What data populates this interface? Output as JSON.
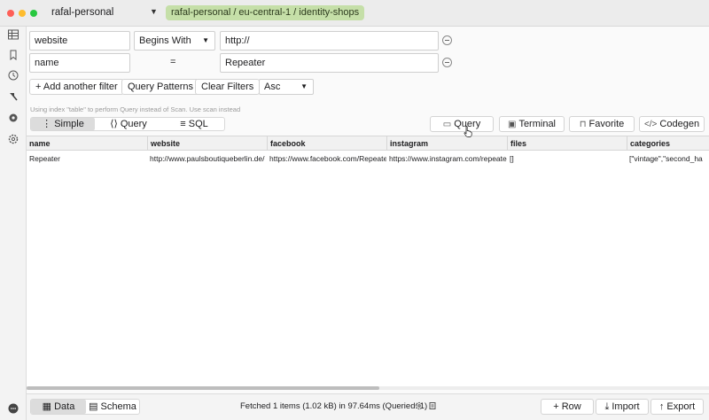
{
  "titlebar": {
    "connection": "rafal-personal",
    "breadcrumb": "rafal-personal / eu-central-1 / identity-shops"
  },
  "sidebar": {
    "icons": [
      "table-icon",
      "bookmark-icon",
      "history-icon",
      "hammer-icon",
      "settings-icon",
      "gear-icon",
      "chat-icon"
    ]
  },
  "filters": [
    {
      "attribute": "website",
      "operator": "Begins With",
      "value": "http://"
    },
    {
      "attribute": "name",
      "operator": "=",
      "value": "Repeater"
    }
  ],
  "filter_actions": {
    "add_filter": "+ Add another filter",
    "query_patterns": "Query Patterns",
    "clear_filters": "Clear Filters",
    "sort": "Asc"
  },
  "hint": "Using index \"table\" to perform Query instead of Scan. Use scan instead",
  "modes": {
    "simple": "Simple",
    "query": "Query",
    "sql": "SQL"
  },
  "toolbar": {
    "query": "Query",
    "terminal": "Terminal",
    "favorite": "Favorite",
    "codegen": "Codegen"
  },
  "table": {
    "columns": [
      "name",
      "website",
      "facebook",
      "instagram",
      "files",
      "categories"
    ],
    "rows": [
      [
        "Repeater",
        "http://www.paulsboutiqueberlin.de/",
        "https://www.facebook.com/Repeater",
        "https://www.instagram.com/repeater",
        "[]",
        "[\"vintage\",\"second_ha"
      ]
    ]
  },
  "bottom": {
    "data_tab": "Data",
    "schema_tab": "Schema",
    "status": "Fetched 1 items (1.02 kB) in 97.64ms (Queried: 1)",
    "row_button": "+ Row",
    "import_button": "Import",
    "export_button": "Export"
  },
  "colors": {
    "breadcrumb_bg": "#c5dfa8",
    "traffic_red": "#fe5f57",
    "traffic_yellow": "#febc2e",
    "traffic_green": "#28c840"
  }
}
